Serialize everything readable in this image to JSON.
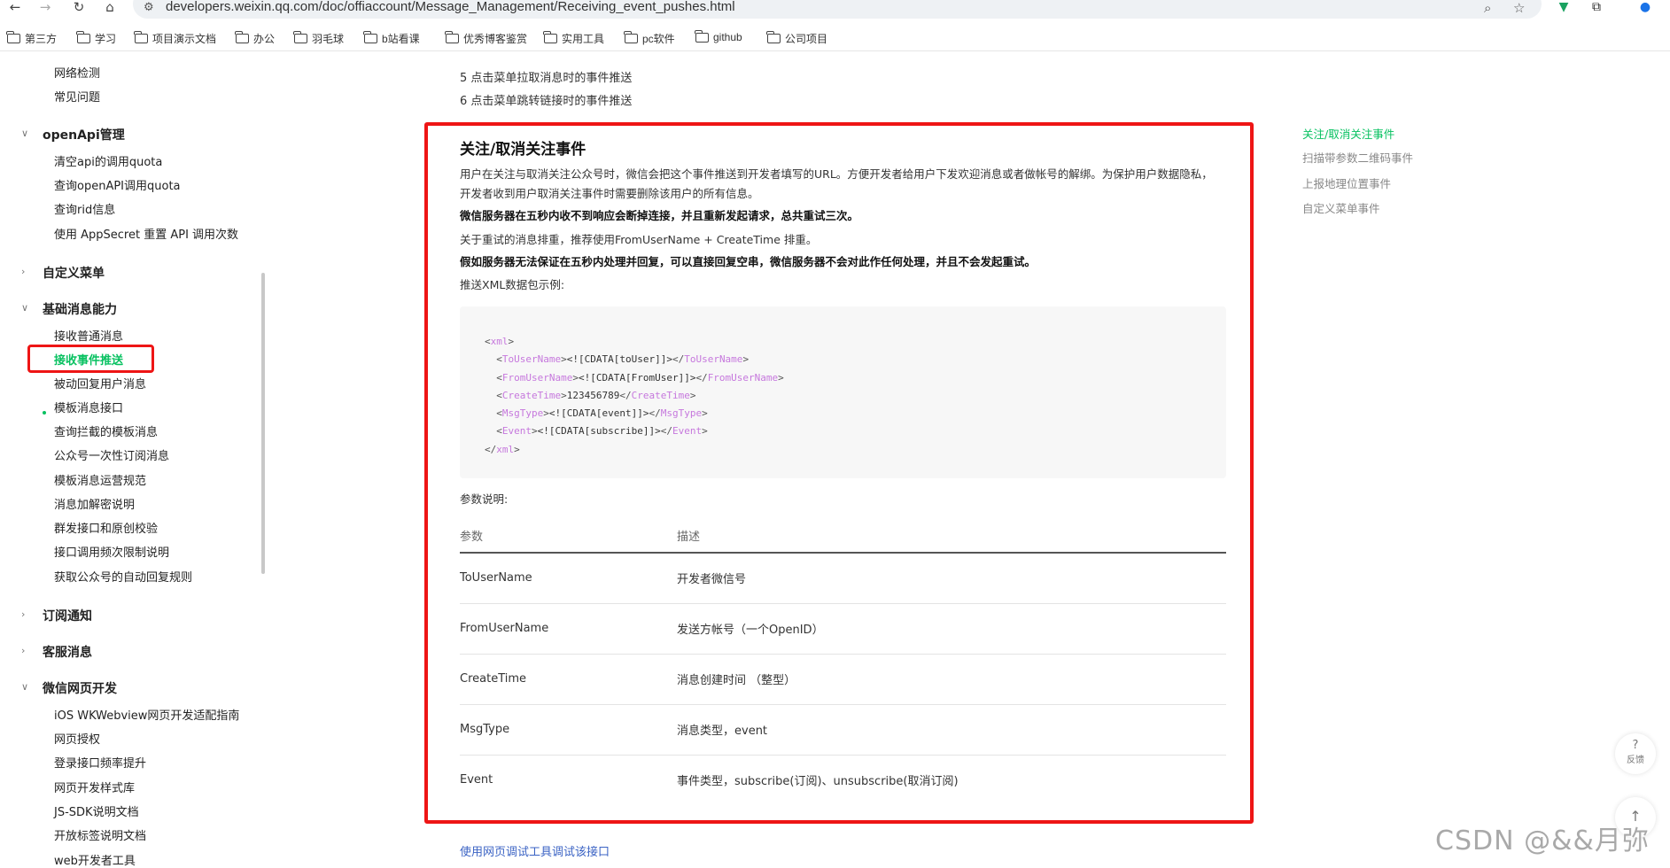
{
  "browser": {
    "url": "developers.weixin.qq.com/doc/offiaccount/Message_Management/Receiving_event_pushes.html",
    "bookmarks": [
      "第三方",
      "学习",
      "项目演示文档",
      "办公",
      "羽毛球",
      "b站看课",
      "优秀博客鉴赏",
      "实用工具",
      "pc软件",
      "github",
      "公司项目"
    ]
  },
  "sidebar": {
    "top_items": [
      "网络检测",
      "常见问题"
    ],
    "group_openapi": {
      "label": "openApi管理",
      "items": [
        "清空api的调用quota",
        "查询openAPI调用quota",
        "查询rid信息",
        "使用 AppSecret 重置 API 调用次数"
      ]
    },
    "group_menu": {
      "label": "自定义菜单"
    },
    "group_basic": {
      "label": "基础消息能力",
      "items": [
        "接收普通消息",
        "接收事件推送",
        "被动回复用户消息",
        "模板消息接口",
        "查询拦截的模板消息",
        "公众号一次性订阅消息",
        "模板消息运营规范",
        "消息加解密说明",
        "群发接口和原创校验",
        "接口调用频次限制说明",
        "获取公众号的自动回复规则"
      ],
      "active_index": 1
    },
    "group_subscribe": {
      "label": "订阅通知"
    },
    "group_service": {
      "label": "客服消息"
    },
    "group_web": {
      "label": "微信网页开发",
      "items": [
        "iOS WKWebview网页开发适配指南",
        "网页授权",
        "登录接口频率提升",
        "网页开发样式库",
        "JS-SDK说明文档",
        "开放标签说明文档",
        "web开发者工具"
      ]
    }
  },
  "content": {
    "pre_items": [
      "5 点击菜单拉取消息时的事件推送",
      "6 点击菜单跳转链接时的事件推送"
    ],
    "title": "关注/取消关注事件",
    "para1_line1": "用户在关注与取消关注公众号时，微信会把这个事件推送到开发者填写的URL。方便开发者给用户下发欢迎消息或者做帐号的解绑。为保护用户数据隐私，",
    "para1_line2": "开发者收到用户取消关注事件时需要删除该用户的所有信息。",
    "para2": "微信服务器在五秒内收不到响应会断掉连接，并且重新发起请求，总共重试三次。",
    "para3": "关于重试的消息排重，推荐使用FromUserName + CreateTime 排重。",
    "para4": "假如服务器无法保证在五秒内处理并回复，可以直接回复空串，微信服务器不会对此作任何处理，并且不会发起重试。",
    "para5": "推送XML数据包示例:",
    "xml": {
      "root": "xml",
      "rows": [
        {
          "tag": "ToUserName",
          "value": "<![CDATA[toUser]]>"
        },
        {
          "tag": "FromUserName",
          "value": "<![CDATA[FromUser]]>"
        },
        {
          "tag": "CreateTime",
          "value": "123456789"
        },
        {
          "tag": "MsgType",
          "value": "<![CDATA[event]]>"
        },
        {
          "tag": "Event",
          "value": "<![CDATA[subscribe]]>"
        }
      ]
    },
    "params_caption": "参数说明:",
    "table": {
      "headers": [
        "参数",
        "描述"
      ],
      "rows": [
        [
          "ToUserName",
          "开发者微信号"
        ],
        [
          "FromUserName",
          "发送方帐号（一个OpenID）"
        ],
        [
          "CreateTime",
          "消息创建时间 （整型）"
        ],
        [
          "MsgType",
          "消息类型，event"
        ],
        [
          "Event",
          "事件类型，subscribe(订阅)、unsubscribe(取消订阅)"
        ]
      ]
    },
    "footer_link": "使用网页调试工具调试该接口"
  },
  "toc": {
    "items": [
      "关注/取消关注事件",
      "扫描带参数二维码事件",
      "上报地理位置事件",
      "自定义菜单事件"
    ],
    "active_index": 0
  },
  "fab": {
    "feedback_label": "反馈",
    "feedback_icon": "?",
    "top_icon": "↑"
  },
  "watermark": "CSDN @&&月弥",
  "colors": {
    "accent": "#07c160",
    "highlight": "#ee1515",
    "link": "#3b63c4"
  }
}
